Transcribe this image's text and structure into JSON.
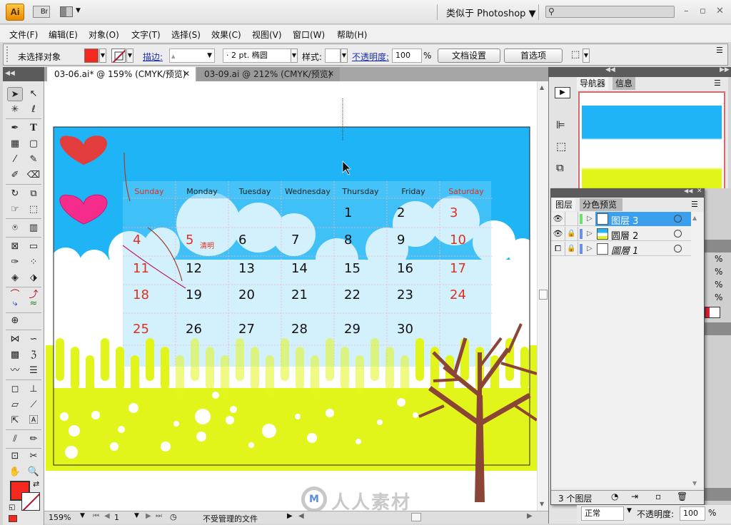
{
  "app": {
    "logo": "Ai",
    "bridge_label": "Br",
    "workspace": "类似于 Photoshop ▼",
    "window_controls": [
      "–",
      "▫",
      "✕"
    ]
  },
  "menu": [
    "文件(F)",
    "编辑(E)",
    "对象(O)",
    "文字(T)",
    "选择(S)",
    "效果(C)",
    "视图(V)",
    "窗口(W)",
    "帮助(H)"
  ],
  "control_bar": {
    "selection_status": "未选择对象",
    "stroke_label": "描边:",
    "brush_value": "· 2 pt. 椭圆",
    "style_label": "样式:",
    "opacity_label": "不透明度:",
    "opacity_value": "100",
    "percent": "%",
    "doc_setup_button": "文档设置",
    "preferences_button": "首选项",
    "fill_color": "#f5281f"
  },
  "tabs": [
    {
      "label": "03-06.ai* @ 159% (CMYK/预览)",
      "active": true
    },
    {
      "label": "03-09.ai @ 212% (CMYK/预览)",
      "active": false
    }
  ],
  "status_bar": {
    "zoom": "159%",
    "page": "1",
    "file_status": "不受管理的文件"
  },
  "calendar": {
    "weekdays": [
      "Sunday",
      "Monday",
      "Tuesday",
      "Wednesday",
      "Thursday",
      "Friday",
      "Saturday"
    ],
    "weeks": [
      [
        "",
        "",
        "",
        "",
        "1",
        "2",
        "3"
      ],
      [
        "4",
        "5",
        "6",
        "7",
        "8",
        "9",
        "10"
      ],
      [
        "11",
        "12",
        "13",
        "14",
        "15",
        "16",
        "17"
      ],
      [
        "18",
        "19",
        "20",
        "21",
        "22",
        "23",
        "24"
      ],
      [
        "25",
        "26",
        "27",
        "28",
        "29",
        "30",
        ""
      ]
    ],
    "holiday_note": "清明",
    "colors": {
      "sky": "#1eb4f6",
      "grass": "#e2f51b",
      "weekend": "#e0301e",
      "tree": "#8b4536",
      "heart1": "#e33c3c",
      "heart2": "#f52c8c"
    }
  },
  "navigator": {
    "tabs": [
      "导航器",
      "信息"
    ]
  },
  "layers_panel": {
    "tabs": [
      "图层",
      "分色预览"
    ],
    "layers": [
      {
        "name": "图层 3",
        "selected": true,
        "locked": false,
        "visible": true,
        "color": "#6be06b"
      },
      {
        "name": "圆層 2",
        "selected": false,
        "locked": true,
        "visible": true,
        "color": "#6b8fe0"
      },
      {
        "name": "圖層 1",
        "selected": false,
        "locked": true,
        "visible": false,
        "color": "#6b8fe0"
      }
    ],
    "count_label": "3 个图层"
  },
  "transparency": {
    "mode": "正常",
    "opacity_label": "不透明度:",
    "opacity_value": "100",
    "percent": "%"
  },
  "watermark": "人人素材"
}
